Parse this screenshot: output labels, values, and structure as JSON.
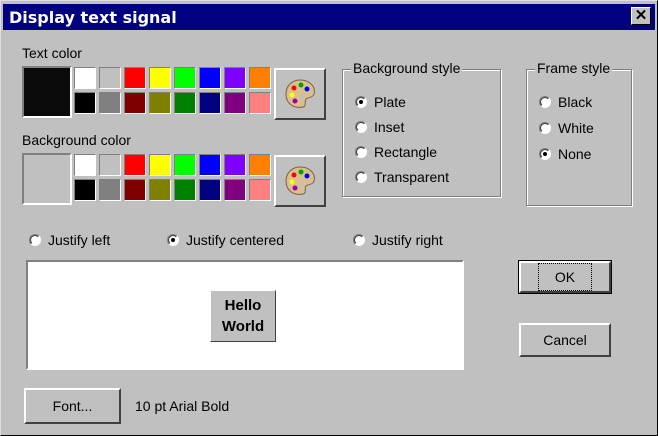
{
  "window": {
    "title": "Display text signal"
  },
  "text_color": {
    "label": "Text color",
    "current": "#0a0a0a",
    "swatches_top": [
      "#ffffff",
      "#c0c0c0",
      "#ff0000",
      "#ffff00",
      "#00ff00",
      "#0000ff",
      "#8000ff",
      "#ff8000"
    ],
    "swatches_bottom": [
      "#000000",
      "#808080",
      "#800000",
      "#808000",
      "#008000",
      "#000080",
      "#800080",
      "#ff8080"
    ],
    "palette_icon": "palette-icon"
  },
  "background_color": {
    "label": "Background color",
    "current": "#c0c0c0",
    "swatches_top": [
      "#ffffff",
      "#c0c0c0",
      "#ff0000",
      "#ffff00",
      "#00ff00",
      "#0000ff",
      "#8000ff",
      "#ff8000"
    ],
    "swatches_bottom": [
      "#000000",
      "#808080",
      "#800000",
      "#808000",
      "#008000",
      "#000080",
      "#800080",
      "#ff8080"
    ],
    "palette_icon": "palette-icon"
  },
  "background_style": {
    "label": "Background style",
    "options": [
      {
        "label": "Plate",
        "checked": true
      },
      {
        "label": "Inset",
        "checked": false
      },
      {
        "label": "Rectangle",
        "checked": false
      },
      {
        "label": "Transparent",
        "checked": false
      }
    ]
  },
  "frame_style": {
    "label": "Frame style",
    "options": [
      {
        "label": "Black",
        "checked": false
      },
      {
        "label": "White",
        "checked": false
      },
      {
        "label": "None",
        "checked": true
      }
    ]
  },
  "justify": {
    "options": [
      {
        "label": "Justify left",
        "checked": false
      },
      {
        "label": "Justify centered",
        "checked": true
      },
      {
        "label": "Justify right",
        "checked": false
      }
    ]
  },
  "preview": {
    "line1": "Hello",
    "line2": "World"
  },
  "buttons": {
    "ok": "OK",
    "cancel": "Cancel",
    "font": "Font..."
  },
  "font_description": "10 pt Arial Bold"
}
